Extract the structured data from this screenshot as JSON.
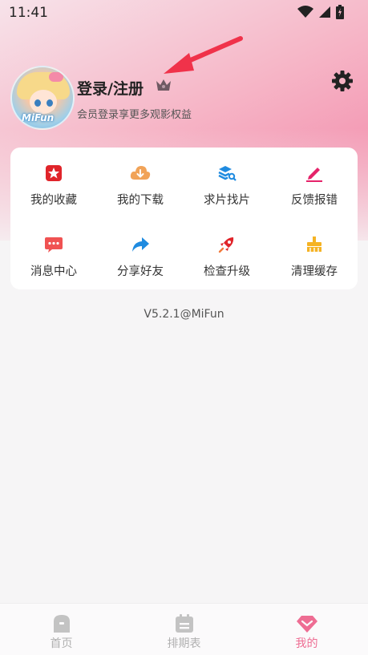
{
  "status_bar": {
    "time": "11:41"
  },
  "profile": {
    "avatar_text": "MiFun",
    "login_label": "登录/注册",
    "subtitle": "会员登录享更多观影权益"
  },
  "menu": {
    "items": [
      {
        "label": "我的收藏",
        "icon": "star-icon",
        "color": "#e0242a"
      },
      {
        "label": "我的下载",
        "icon": "download-cloud-icon",
        "color": "#f1a358"
      },
      {
        "label": "求片找片",
        "icon": "search-stack-icon",
        "color": "#1f8be0"
      },
      {
        "label": "反馈报错",
        "icon": "edit-pen-icon",
        "color": "#e5236a"
      },
      {
        "label": "消息中心",
        "icon": "message-icon",
        "color": "#f05252"
      },
      {
        "label": "分享好友",
        "icon": "share-icon",
        "color": "#1f8be0"
      },
      {
        "label": "检查升级",
        "icon": "rocket-icon",
        "color": "#e0242a"
      },
      {
        "label": "清理缓存",
        "icon": "broom-icon",
        "color": "#f5b324"
      }
    ]
  },
  "version": "V5.2.1@MiFun",
  "bottom_nav": {
    "items": [
      {
        "label": "首页",
        "icon": "home-icon",
        "active": false
      },
      {
        "label": "排期表",
        "icon": "calendar-icon",
        "active": false
      },
      {
        "label": "我的",
        "icon": "diamond-icon",
        "active": true
      }
    ]
  },
  "colors": {
    "accent": "#ee6d93",
    "arrow": "#f0324a"
  }
}
